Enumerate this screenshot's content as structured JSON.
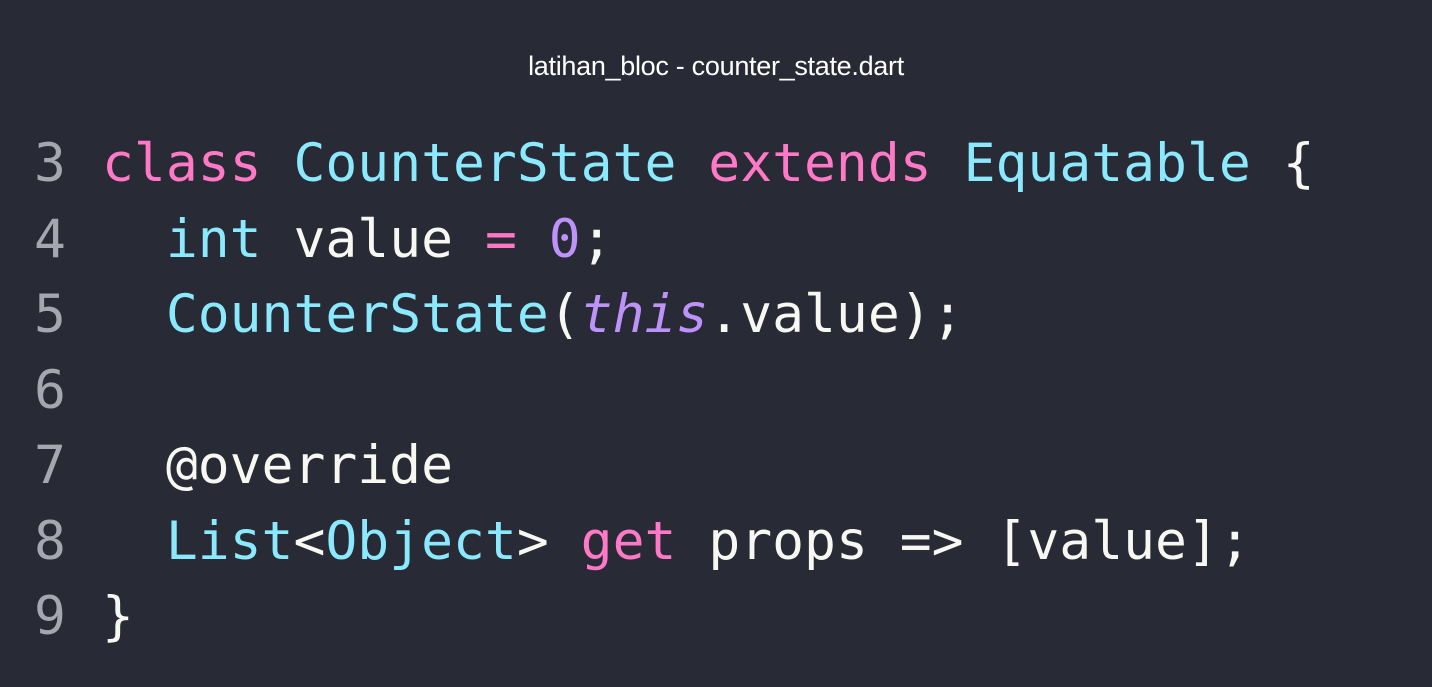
{
  "window": {
    "title": "latihan_bloc - counter_state.dart"
  },
  "theme": {
    "background": "#282a36",
    "foreground": "#f8f8f2",
    "line_number": "#a4a7b0",
    "keyword": "#ff79c6",
    "type": "#8be9fd",
    "number": "#bd93f9"
  },
  "code": {
    "lines": [
      {
        "number": "3",
        "tokens": [
          {
            "text": "class",
            "kind": "kw"
          },
          {
            "text": " ",
            "kind": "tx"
          },
          {
            "text": "CounterState",
            "kind": "ty"
          },
          {
            "text": " ",
            "kind": "tx"
          },
          {
            "text": "extends",
            "kind": "kw"
          },
          {
            "text": " ",
            "kind": "tx"
          },
          {
            "text": "Equatable",
            "kind": "ty"
          },
          {
            "text": " {",
            "kind": "tx"
          }
        ]
      },
      {
        "number": "4",
        "tokens": [
          {
            "text": "  ",
            "kind": "tx"
          },
          {
            "text": "int",
            "kind": "ty"
          },
          {
            "text": " value ",
            "kind": "tx"
          },
          {
            "text": "=",
            "kind": "kw"
          },
          {
            "text": " ",
            "kind": "tx"
          },
          {
            "text": "0",
            "kind": "num"
          },
          {
            "text": ";",
            "kind": "tx"
          }
        ]
      },
      {
        "number": "5",
        "tokens": [
          {
            "text": "  ",
            "kind": "tx"
          },
          {
            "text": "CounterState",
            "kind": "ty"
          },
          {
            "text": "(",
            "kind": "tx"
          },
          {
            "text": "this",
            "kind": "it"
          },
          {
            "text": ".value);",
            "kind": "tx"
          }
        ]
      },
      {
        "number": "6",
        "tokens": []
      },
      {
        "number": "7",
        "tokens": [
          {
            "text": "  @override",
            "kind": "tx"
          }
        ]
      },
      {
        "number": "8",
        "tokens": [
          {
            "text": "  ",
            "kind": "tx"
          },
          {
            "text": "List",
            "kind": "ty"
          },
          {
            "text": "<",
            "kind": "tx"
          },
          {
            "text": "Object",
            "kind": "ty"
          },
          {
            "text": "> ",
            "kind": "tx"
          },
          {
            "text": "get",
            "kind": "kw"
          },
          {
            "text": " props => [value];",
            "kind": "tx"
          }
        ]
      },
      {
        "number": "9",
        "tokens": [
          {
            "text": "}",
            "kind": "tx"
          }
        ]
      }
    ]
  }
}
